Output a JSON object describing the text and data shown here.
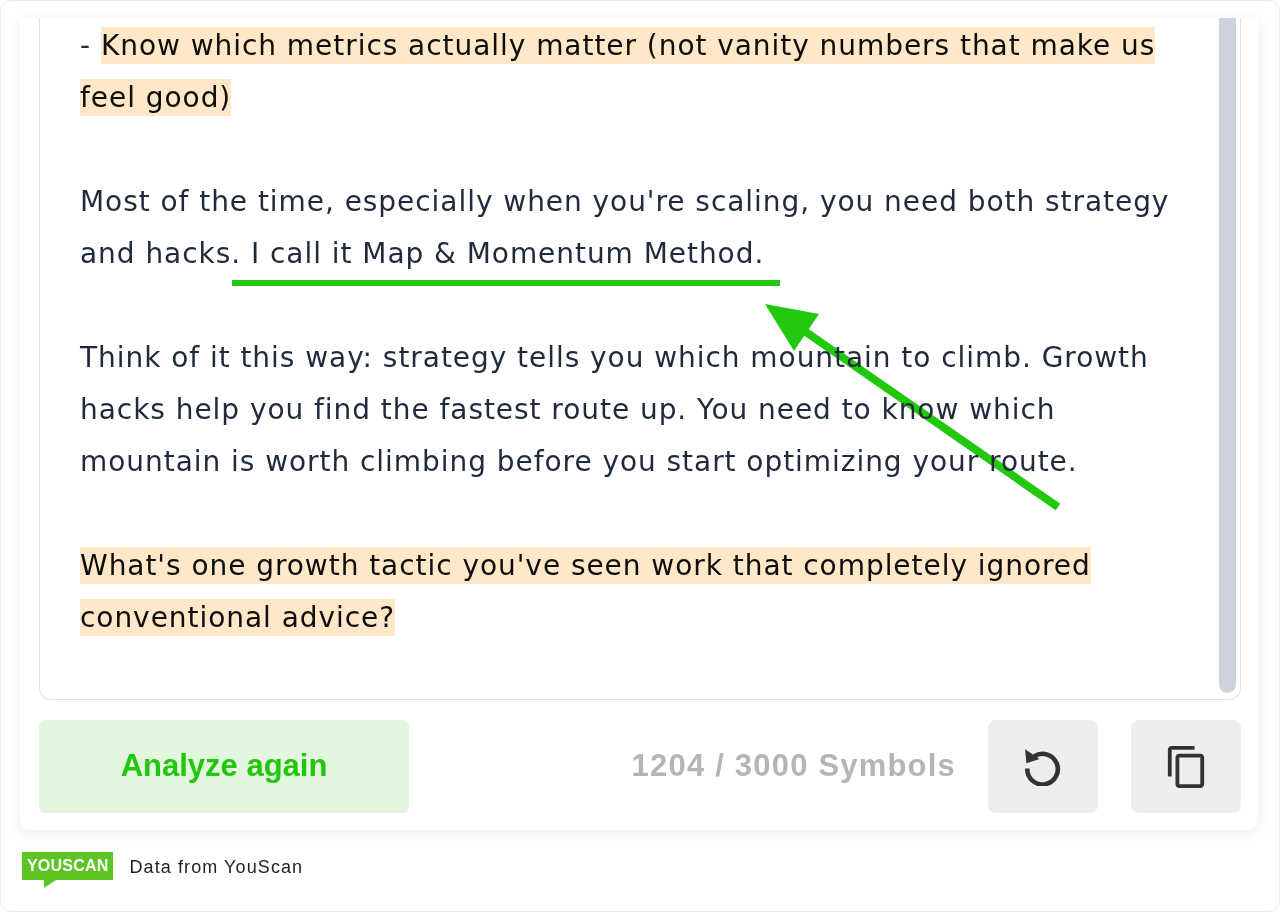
{
  "editor": {
    "paragraphs": [
      {
        "segments": [
          {
            "text": "- ",
            "highlighted": false,
            "underlined": false,
            "arrow": false
          },
          {
            "text": "Know which metrics actually matter (not vanity numbers that make us feel good)",
            "highlighted": true,
            "underlined": false,
            "arrow": false
          }
        ]
      },
      {
        "segments": [
          {
            "text": "Most of the time, especially when you're scaling, you need both strategy and hacks.",
            "highlighted": false,
            "underlined": false,
            "arrow": false
          },
          {
            "text": " I call it Map & Momentum Method.",
            "highlighted": false,
            "underlined": true,
            "arrow": true
          }
        ]
      },
      {
        "segments": [
          {
            "text": "Think of it this way: strategy tells you which mountain to climb. Growth hacks help you find the fastest route up. You need to know which mountain is worth climbing before you start optimizing your route.",
            "highlighted": false,
            "underlined": false,
            "arrow": false
          }
        ]
      },
      {
        "segments": [
          {
            "text": "What's one growth tactic you've seen work that completely ignored conventional advice?",
            "highlighted": true,
            "underlined": false,
            "arrow": false
          }
        ]
      }
    ]
  },
  "analyze_button": {
    "label": "Analyze again"
  },
  "counter": "1204 / 3000 Symbols",
  "footer": {
    "logo": "YOUSCAN",
    "caption": "Data from YouScan"
  }
}
